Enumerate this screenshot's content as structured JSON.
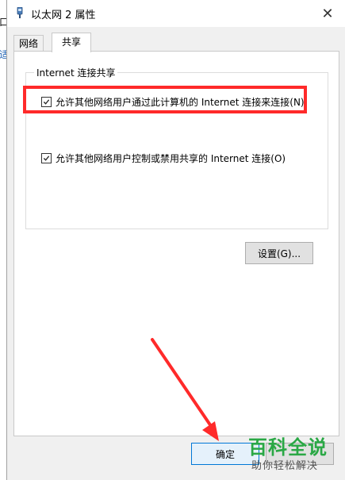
{
  "background_window": {
    "fragment_1": "口",
    "fragment_2": "适"
  },
  "dialog": {
    "title": "以太网 2 属性",
    "close_glyph": "✕",
    "tabs": [
      {
        "label": "网络"
      },
      {
        "label": "共享"
      }
    ],
    "group_title": "Internet 连接共享",
    "allow_share_label": "允许其他网络用户通过此计算机的 Internet 连接来连接(N)",
    "allow_share_checked": true,
    "allow_control_label": "允许其他网络用户控制或禁用共享的 Internet 连接(O)",
    "allow_control_checked": true,
    "settings_button": "设置(G)...",
    "ok_button": "确定"
  },
  "annotation": {
    "highlight_color": "#ff2a2a",
    "arrow_color": "#ff2a2a"
  },
  "watermark": {
    "title": "百科全说",
    "subtitle": "助你轻松解决",
    "color": "#2aa845"
  }
}
